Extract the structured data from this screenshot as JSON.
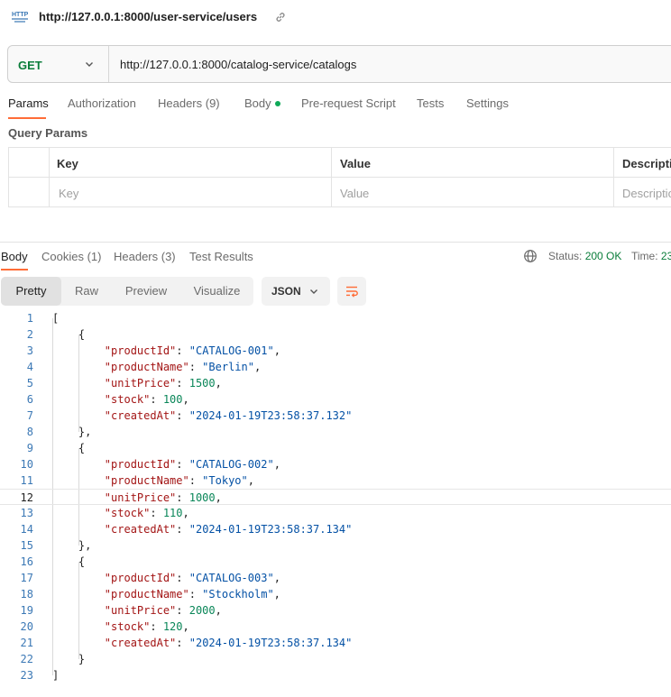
{
  "header": {
    "title": "http://127.0.0.1:8000/user-service/users"
  },
  "request": {
    "method": "GET",
    "url": "http://127.0.0.1:8000/catalog-service/catalogs"
  },
  "request_tabs": [
    {
      "label": "Params"
    },
    {
      "label": "Authorization"
    },
    {
      "label": "Headers (9)"
    },
    {
      "label": "Body"
    },
    {
      "label": "Pre-request Script"
    },
    {
      "label": "Tests"
    },
    {
      "label": "Settings"
    }
  ],
  "query_params": {
    "label": "Query Params",
    "columns": [
      "Key",
      "Value",
      "Description"
    ],
    "placeholders": [
      "Key",
      "Value",
      "Description"
    ]
  },
  "response_tabs": [
    {
      "label": "Body"
    },
    {
      "label": "Cookies (1)"
    },
    {
      "label": "Headers (3)"
    },
    {
      "label": "Test Results"
    }
  ],
  "status": {
    "label": "Status:",
    "value": "200 OK",
    "time_label": "Time:",
    "time_value": "23"
  },
  "view_modes": [
    {
      "label": "Pretty"
    },
    {
      "label": "Raw"
    },
    {
      "label": "Preview"
    },
    {
      "label": "Visualize"
    }
  ],
  "format": "JSON",
  "code_lines": [
    {
      "no": "1"
    },
    {
      "no": "2"
    },
    {
      "no": "3"
    },
    {
      "no": "4"
    },
    {
      "no": "5"
    },
    {
      "no": "6"
    },
    {
      "no": "7"
    },
    {
      "no": "8"
    },
    {
      "no": "9"
    },
    {
      "no": "10"
    },
    {
      "no": "11"
    },
    {
      "no": "12"
    },
    {
      "no": "13"
    },
    {
      "no": "14"
    },
    {
      "no": "15"
    },
    {
      "no": "16"
    },
    {
      "no": "17"
    },
    {
      "no": "18"
    },
    {
      "no": "19"
    },
    {
      "no": "20"
    },
    {
      "no": "21"
    },
    {
      "no": "22"
    },
    {
      "no": "23"
    }
  ],
  "response_body": [
    {
      "productId": "CATALOG-001",
      "productName": "Berlin",
      "unitPrice": "1500",
      "stock": "100",
      "createdAt": "2024-01-19T23:58:37.132"
    },
    {
      "productId": "CATALOG-002",
      "productName": "Tokyo",
      "unitPrice": "1000",
      "stock": "110",
      "createdAt": "2024-01-19T23:58:37.134"
    },
    {
      "productId": "CATALOG-003",
      "productName": "Stockholm",
      "unitPrice": "2000",
      "stock": "120",
      "createdAt": "2024-01-19T23:58:37.134"
    }
  ],
  "colors": {
    "accent": "#ff6c37",
    "method": "#0a7d3a",
    "status_ok": "#0a7d3a",
    "json_key": "#a31515",
    "json_string": "#0451a5",
    "json_number": "#098658"
  }
}
